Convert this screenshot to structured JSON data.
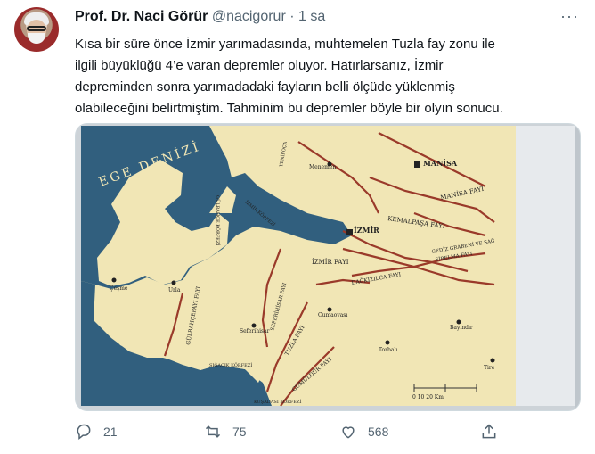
{
  "tweet": {
    "author_name": "Prof. Dr. Naci Görür",
    "handle": "@nacigorur",
    "separator": "·",
    "time": "1 sa",
    "more_label": "···",
    "text_lines": [
      "Kısa bir süre önce İzmir yarımadasında, muhtemelen Tuzla fay zonu ile",
      "ilgili büyüklüğü 4’e varan depremler oluyor. Hatırlarsanız, İzmir",
      "depreminden sonra yarımadadaki fayların belli ölçüde yüklenmiş",
      "olabileceğini belirtmiştim. Tahminim bu depremler böyle bir olyın sonucu."
    ]
  },
  "map": {
    "sea_label": "EGE DENİZİ",
    "labels": {
      "manisa": "MANİSA",
      "manisa_fayi": "MANİSA FAYI",
      "menemen": "Menemen",
      "kemalpasa_fayi": "KEMALPAŞA FAYI",
      "izmir": "İZMİR",
      "izmir_fayi": "İZMİR FAYI",
      "gediz": "GEDİZ GRABENİ VE SAĞ",
      "gediz2": "SİRELMA FAYI",
      "dagkizilca": "DAĞKIZILCA FAYI",
      "urla": "Urla",
      "cesme": "Çeşme",
      "seferihisar": "Seferihisar",
      "cumaovasi": "Cumaovası",
      "torbali": "Torbalı",
      "bayindir": "Bayındır",
      "tire": "Tire",
      "gulbahce": "GÜLBAHÇE KÖRFEZİ",
      "izmir_korfezi": "İZMİR KÖRFEZİ",
      "gulbahce_fayi": "GÜLBAHÇEPAYI FAYI",
      "seferihisar_fayi": "SEFERİHİSAR FAYI",
      "tuzla": "TUZLA FAYI",
      "gumuldur": "GÜMÜLDÜR FAYI",
      "sigacik": "SIĞACIK KÖRFEZİ",
      "kusadasi": "KUŞADASI KÖRFEZİ",
      "yenifoca": "YENİFOÇA",
      "scale": "0   10   20 Km"
    }
  },
  "actions": {
    "reply_count": "21",
    "retweet_count": "75",
    "like_count": "568"
  },
  "colors": {
    "text": "#0f1419",
    "muted": "#536471",
    "land": "#f1e6b5",
    "sea": "#315f7e",
    "fault": "#9a3a2a"
  }
}
